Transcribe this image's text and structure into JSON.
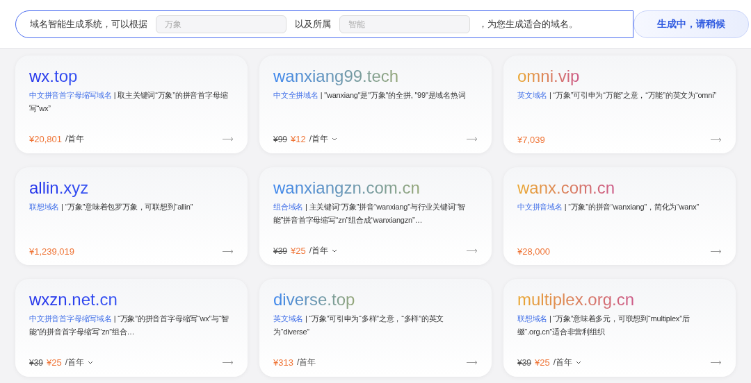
{
  "search": {
    "prefix": "域名智能生成系统，可以根据",
    "keyword_placeholder": "万象",
    "middle": "以及所属",
    "industry_placeholder": "智能",
    "suffix": "，为您生成适合的域名。",
    "button": "生成中，请稍候"
  },
  "cards": [
    {
      "domain": "wx.top",
      "kind": "blue",
      "category": "中文拼音首字母缩写域名",
      "description": " | 取主关键词“万象”的拼音首字母缩写“wx”",
      "price": "¥20,801",
      "period": "/首年",
      "dropdown": false
    },
    {
      "domain": "wanxiang99.tech",
      "kind": "teal",
      "category": "中文全拼域名",
      "description": " | \"wanxiang\"是\"万象\"的全拼, \"99\"是域名热词",
      "original_price": "¥99",
      "price": "¥12",
      "period": "/首年",
      "dropdown": true
    },
    {
      "domain": "omni.vip",
      "kind": "warm",
      "category": "英文域名",
      "description": " | “万象”可引申为“万能”之意，“万能”的英文为“omni”",
      "price": "¥7,039",
      "dropdown": false
    },
    {
      "domain": "allin.xyz",
      "kind": "blue",
      "category": "联想域名",
      "description": " | “万象”意味着包罗万象，可联想到“allin”",
      "price": "¥1,239,019",
      "dropdown": false
    },
    {
      "domain": "wanxiangzn.com.cn",
      "kind": "teal",
      "category": "组合域名",
      "description": " | 主关键词“万象”拼音“wanxiang”与行业关键词“智能”拼音首字母缩写“zn”组合成“wanxiangzn”…",
      "original_price": "¥39",
      "price": "¥25",
      "period": "/首年",
      "dropdown": true
    },
    {
      "domain": "wanx.com.cn",
      "kind": "warm",
      "category": "中文拼音域名",
      "description": " | “万象”的拼音“wanxiang”，简化为“wanx”",
      "price": "¥28,000",
      "dropdown": false
    },
    {
      "domain": "wxzn.net.cn",
      "kind": "blue",
      "category": "中文拼音首字母缩写域名",
      "description": " | “万象”的拼音首字母缩写“wx”与“智能”的拼音首字母缩写“zn”组合…",
      "original_price": "¥39",
      "price": "¥25",
      "period": "/首年",
      "dropdown": true
    },
    {
      "domain": "diverse.top",
      "kind": "teal",
      "category": "英文域名",
      "description": " | “万象”可引申为“多样”之意，“多样”的英文为“diverse”",
      "price": "¥313",
      "period": "/首年",
      "dropdown": false
    },
    {
      "domain": "multiplex.org.cn",
      "kind": "warm",
      "category": "联想域名",
      "description": " | “万象”意味着多元，可联想到“multiplex”后缀“.org.cn”适合非营利组织",
      "original_price": "¥39",
      "price": "¥25",
      "period": "/首年",
      "dropdown": true
    }
  ]
}
